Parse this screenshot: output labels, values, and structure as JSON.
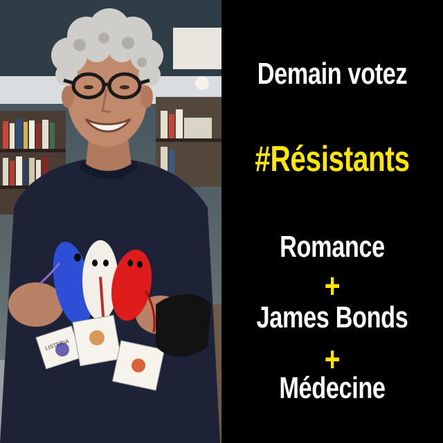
{
  "colors": {
    "background": "#000000",
    "text": "#ffffff",
    "accent": "#ffe600"
  },
  "photo": {
    "plush_tag_labels": [
      "LISTERIA"
    ]
  },
  "slogan": {
    "line1": "Demain votez",
    "hashtag": "#Résistants",
    "line3": "Romance",
    "plus1": "+",
    "line4": "James Bonds",
    "plus2": "+",
    "line5": "Médecine"
  }
}
